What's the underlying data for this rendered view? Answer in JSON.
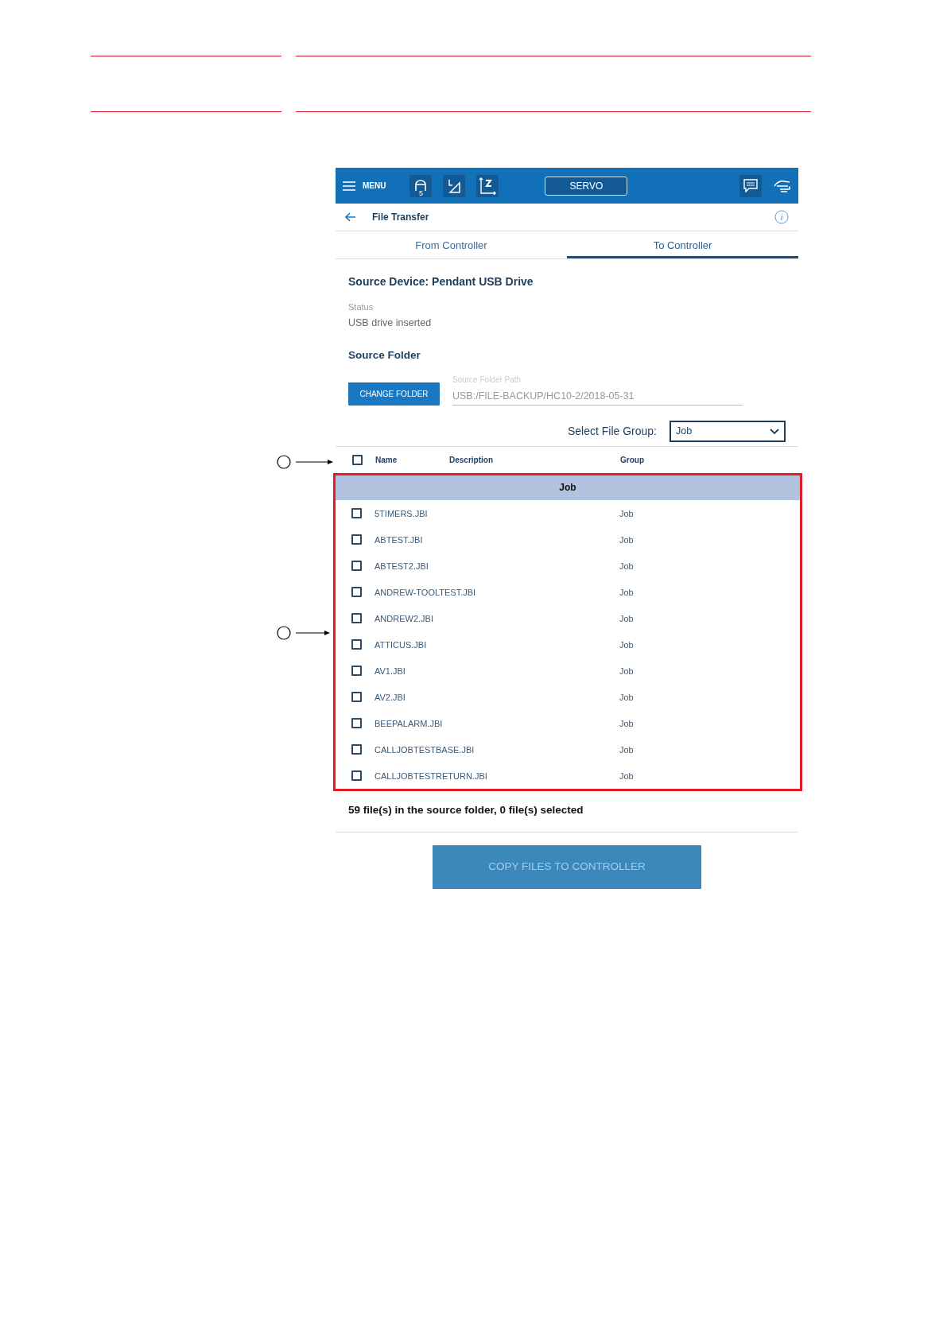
{
  "toolbar": {
    "menu_label": "MENU",
    "tool_number": "5",
    "servo_button": "SERVO"
  },
  "header": {
    "title": "File Transfer"
  },
  "tabs": [
    {
      "label": "From Controller",
      "selected": false
    },
    {
      "label": "To Controller",
      "selected": true
    }
  ],
  "source_device": "Source Device: Pendant USB Drive",
  "status": {
    "label": "Status",
    "value": "USB drive inserted"
  },
  "source_folder": {
    "heading": "Source Folder",
    "button": "CHANGE FOLDER",
    "path_label": "Source Folder Path",
    "path": "USB:/FILE-BACKUP/HC10-2/2018-05-31"
  },
  "file_group": {
    "label": "Select File Group:",
    "value": "Job"
  },
  "table": {
    "columns": [
      "Name",
      "Description",
      "Group"
    ],
    "all_checked": false,
    "group_title": "Job",
    "rows": [
      {
        "name": "5TIMERS.JBI",
        "group": "Job",
        "checked": false
      },
      {
        "name": "ABTEST.JBI",
        "group": "Job",
        "checked": false
      },
      {
        "name": "ABTEST2.JBI",
        "group": "Job",
        "checked": false
      },
      {
        "name": "ANDREW-TOOLTEST.JBI",
        "group": "Job",
        "checked": false
      },
      {
        "name": "ANDREW2.JBI",
        "group": "Job",
        "checked": false
      },
      {
        "name": "ATTICUS.JBI",
        "group": "Job",
        "checked": false
      },
      {
        "name": "AV1.JBI",
        "group": "Job",
        "checked": false
      },
      {
        "name": "AV2.JBI",
        "group": "Job",
        "checked": false
      },
      {
        "name": "BEEPALARM.JBI",
        "group": "Job",
        "checked": false
      },
      {
        "name": "CALLJOBTESTBASE.JBI",
        "group": "Job",
        "checked": false
      },
      {
        "name": "CALLJOBTESTRETURN.JBI",
        "group": "Job",
        "checked": false
      }
    ]
  },
  "summary": "59 file(s) in the source folder, 0 file(s) selected",
  "copy_button": {
    "label": "COPY FILES TO CONTROLLER",
    "disabled": true
  }
}
